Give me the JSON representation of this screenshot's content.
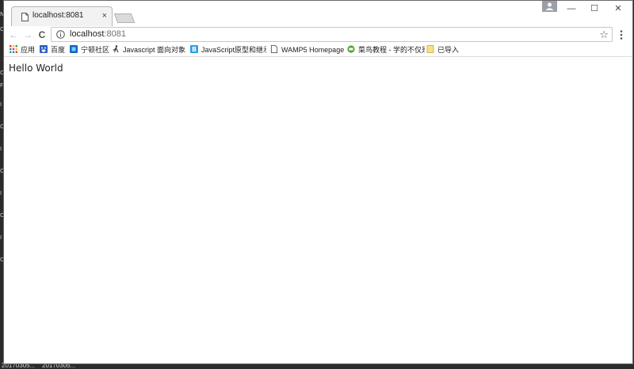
{
  "browser": {
    "tab": {
      "title": "localhost:8081",
      "close_glyph": "×"
    },
    "window_controls": {
      "minimize": "—",
      "maximize": "☐",
      "close": "✕"
    },
    "nav": {
      "back": "←",
      "forward": "→",
      "reload": "C"
    },
    "address": {
      "host": "localhost",
      "port": ":8081",
      "star_glyph": "☆"
    },
    "icons": {
      "tab": "page-icon",
      "info": "info-icon",
      "menu": "kebab-menu-icon",
      "profile": "profile-icon"
    }
  },
  "bookmarks": {
    "items": [
      {
        "label": "应用",
        "icon": "apps-grid-icon"
      },
      {
        "label": "百度",
        "icon": "baidu-icon"
      },
      {
        "label": "宁顿社区",
        "icon": "site-icon"
      },
      {
        "label": "Javascript 面向对象",
        "icon": "runner-icon"
      },
      {
        "label": "JavaScript原型和继承",
        "icon": "b-icon"
      },
      {
        "label": "WAMP5 Homepage",
        "icon": "page-icon"
      },
      {
        "label": "菜鸟教程 - 学的不仅是",
        "icon": "runoob-icon"
      },
      {
        "label": "已导入",
        "icon": "folder-icon"
      }
    ]
  },
  "page": {
    "text": "Hello World"
  },
  "desktop": {
    "taskbar_labels": [
      "20170305...",
      "20170305..."
    ],
    "left_edge_text": [
      "N",
      "C",
      "C",
      "F",
      "I",
      "C",
      "I",
      "C",
      "I",
      "C",
      "I",
      "C"
    ]
  }
}
